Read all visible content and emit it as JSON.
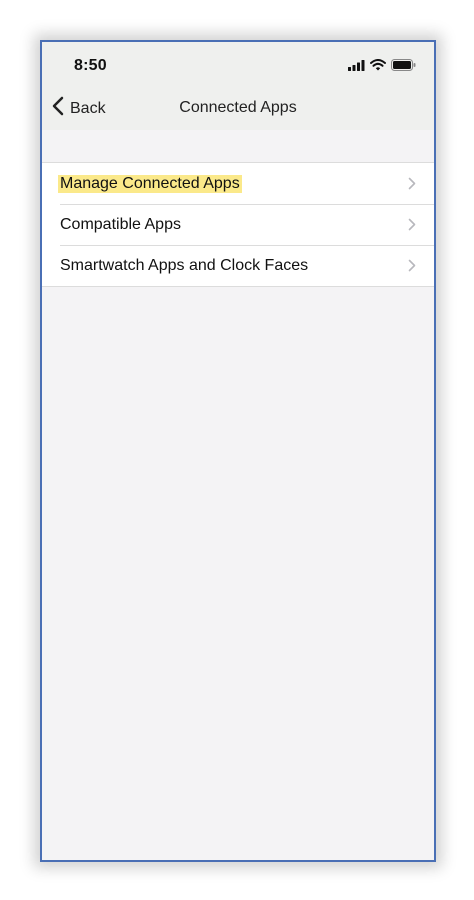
{
  "status_bar": {
    "time": "8:50",
    "icons": [
      "cellular-signal-icon",
      "wifi-icon",
      "battery-icon"
    ]
  },
  "nav": {
    "back_label": "Back",
    "title": "Connected Apps"
  },
  "list": {
    "items": [
      {
        "label": "Manage Connected Apps",
        "highlighted": true
      },
      {
        "label": "Compatible Apps",
        "highlighted": false
      },
      {
        "label": "Smartwatch Apps and Clock Faces",
        "highlighted": false
      }
    ]
  },
  "colors": {
    "frame_border": "#4a6fb5",
    "highlight": "#fbe98a",
    "bar_background": "#eff0ee",
    "page_background": "#f4f3f5"
  }
}
